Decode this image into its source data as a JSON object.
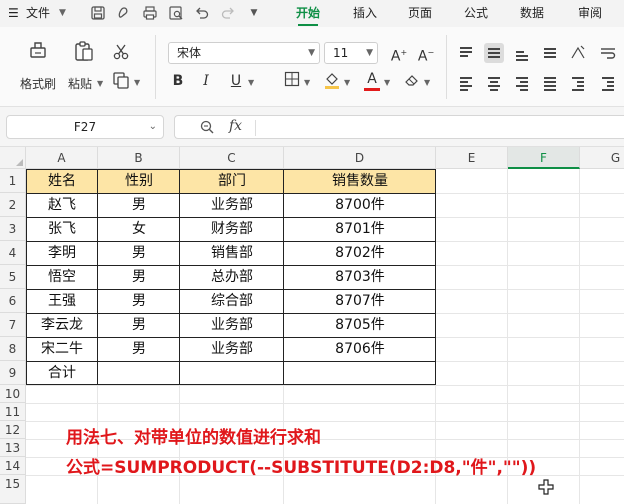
{
  "menu": {
    "file": "文件",
    "tabs": [
      "开始",
      "插入",
      "页面",
      "公式",
      "数据",
      "审阅"
    ],
    "active_tab": "开始"
  },
  "ribbon": {
    "format_painter": "格式刷",
    "paste": "粘贴",
    "font_name": "宋体",
    "font_size": "11"
  },
  "formula_bar": {
    "name_box": "F27",
    "formula": ""
  },
  "grid": {
    "columns": [
      "A",
      "B",
      "C",
      "D",
      "E",
      "F",
      "G"
    ],
    "selected_column": "F",
    "rows": [
      "1",
      "2",
      "3",
      "4",
      "5",
      "6",
      "7",
      "8",
      "9",
      "10",
      "11",
      "12",
      "13",
      "14",
      "15"
    ],
    "table": {
      "header": [
        "姓名",
        "性别",
        "部门",
        "销售数量"
      ],
      "data": [
        [
          "赵飞",
          "男",
          "业务部",
          "8700件"
        ],
        [
          "张飞",
          "女",
          "财务部",
          "8701件"
        ],
        [
          "李明",
          "男",
          "销售部",
          "8702件"
        ],
        [
          "悟空",
          "男",
          "总办部",
          "8703件"
        ],
        [
          "王强",
          "男",
          "综合部",
          "8707件"
        ],
        [
          "李云龙",
          "男",
          "业务部",
          "8705件"
        ],
        [
          "宋二牛",
          "男",
          "业务部",
          "8706件"
        ]
      ],
      "total_label": "合计"
    },
    "notes": [
      "用法七、对带单位的数值进行求和",
      "公式=SUMPRODUCT(--SUBSTITUTE(D2:D8,\"件\",\"\"))"
    ]
  }
}
